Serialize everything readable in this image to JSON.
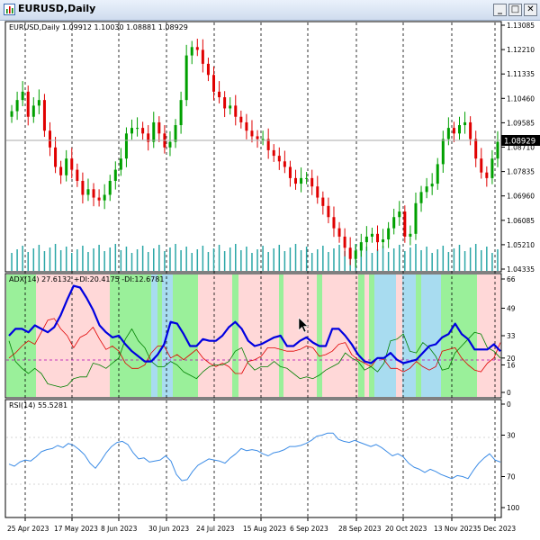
{
  "window": {
    "title": "EURUSD,Daily",
    "buttons": {
      "minimize": "_",
      "restore": "□",
      "close": "✕"
    }
  },
  "main_panel": {
    "header": "EURUSD,Daily  1.09912 1.10030 1.08881 1.08929",
    "current_price": "1.08929",
    "price_ticks": [
      "1.13085",
      "1.12210",
      "1.11335",
      "1.10460",
      "1.09585",
      "1.08710",
      "1.07835",
      "1.06960",
      "1.06085",
      "1.05210",
      "1.04335"
    ]
  },
  "adx_panel": {
    "header": "ADX(14) 27.6132 +DI:20.4175 -DI:12.6781",
    "ticks": [
      "66",
      "49",
      "33",
      "20",
      "16",
      "0"
    ]
  },
  "rsi_panel": {
    "header": "RSI(14) 55.5281",
    "ticks": [
      "100",
      "70",
      "30",
      "0"
    ]
  },
  "date_ticks": [
    "25 Apr 2023",
    "17 May 2023",
    "8 Jun 2023",
    "30 Jun 2023",
    "24 Jul 2023",
    "15 Aug 2023",
    "6 Sep 2023",
    "28 Sep 2023",
    "20 Oct 2023",
    "13 Nov 2023",
    "5 Dec 2023"
  ],
  "colors": {
    "bull_candle": "#00a000",
    "bear_candle": "#e00000",
    "volume": "#2aa6a6",
    "adx": "#0000e0",
    "plus_di": "#008000",
    "minus_di": "#e00000",
    "rsi": "#3c8ce6",
    "zone_green": "#9af09a",
    "zone_pink": "#ffd8d8",
    "zone_cyan": "#a8dcf0"
  },
  "chart_data": {
    "type": "line",
    "x_range": [
      "25 Apr 2023",
      "12 Dec 2023"
    ],
    "price_series": [
      1.1,
      1.104,
      1.107,
      1.098,
      1.102,
      1.104,
      1.093,
      1.087,
      1.08,
      1.077,
      1.083,
      1.079,
      1.075,
      1.07,
      1.072,
      1.069,
      1.068,
      1.07,
      1.075,
      1.079,
      1.083,
      1.092,
      1.094,
      1.094,
      1.092,
      1.089,
      1.096,
      1.092,
      1.087,
      1.089,
      1.095,
      1.104,
      1.12,
      1.123,
      1.122,
      1.117,
      1.113,
      1.107,
      1.105,
      1.101,
      1.102,
      1.098,
      1.096,
      1.093,
      1.091,
      1.09,
      1.09,
      1.086,
      1.084,
      1.082,
      1.08,
      1.076,
      1.074,
      1.076,
      1.076,
      1.073,
      1.069,
      1.066,
      1.062,
      1.058,
      1.055,
      1.051,
      1.047,
      1.05,
      1.053,
      1.055,
      1.056,
      1.053,
      1.054,
      1.058,
      1.062,
      1.064,
      1.055,
      1.056,
      1.067,
      1.071,
      1.073,
      1.074,
      1.081,
      1.09,
      1.094,
      1.092,
      1.095,
      1.096,
      1.09,
      1.083,
      1.078,
      1.076,
      1.083,
      1.089
    ],
    "adx_series": [
      33,
      37,
      37,
      35,
      39,
      37,
      35,
      38,
      45,
      54,
      62,
      61,
      55,
      48,
      39,
      35,
      32,
      33,
      28,
      24,
      21,
      18,
      18,
      22,
      28,
      41,
      40,
      34,
      27,
      27,
      31,
      30,
      30,
      33,
      38,
      41,
      37,
      30,
      27,
      28,
      30,
      32,
      33,
      27,
      27,
      30,
      32,
      29,
      27,
      27,
      37,
      37,
      33,
      28,
      22,
      18,
      17,
      20,
      20,
      23,
      19,
      17,
      18,
      19,
      23,
      27,
      28,
      32,
      34,
      40,
      34,
      31,
      25,
      25,
      25,
      28,
      24
    ],
    "plus_di_series": [
      30,
      18,
      14,
      11,
      14,
      11,
      5,
      4,
      3,
      4,
      8,
      9,
      9,
      17,
      16,
      14,
      17,
      20,
      31,
      37,
      30,
      26,
      18,
      15,
      15,
      18,
      16,
      12,
      10,
      8,
      12,
      15,
      16,
      16,
      18,
      24,
      26,
      17,
      13,
      15,
      15,
      18,
      15,
      14,
      11,
      8,
      9,
      8,
      10,
      13,
      15,
      17,
      23,
      20,
      18,
      13,
      15,
      12,
      17,
      30,
      31,
      34,
      24,
      23,
      29,
      26,
      21,
      13,
      14,
      23,
      27,
      31,
      35,
      34,
      26,
      24,
      20
    ],
    "minus_di_series": [
      20,
      23,
      27,
      30,
      28,
      35,
      42,
      43,
      37,
      33,
      26,
      32,
      34,
      38,
      31,
      25,
      27,
      24,
      17,
      14,
      14,
      16,
      23,
      27,
      27,
      20,
      22,
      19,
      22,
      25,
      20,
      17,
      15,
      17,
      15,
      11,
      11,
      18,
      19,
      21,
      26,
      26,
      25,
      24,
      24,
      25,
      27,
      26,
      21,
      22,
      24,
      28,
      29,
      22,
      19,
      17,
      15,
      20,
      19,
      14,
      14,
      12,
      14,
      18,
      15,
      13,
      15,
      24,
      25,
      26,
      20,
      16,
      13,
      12,
      17,
      20,
      29
    ],
    "rsi_series": [
      58,
      60,
      56,
      54,
      55,
      51,
      46,
      44,
      43,
      40,
      42,
      38,
      40,
      44,
      49,
      57,
      62,
      55,
      47,
      41,
      37,
      36,
      39,
      47,
      53,
      52,
      56,
      55,
      54,
      50,
      55,
      68,
      74,
      73,
      65,
      59,
      56,
      53,
      54,
      55,
      57,
      52,
      48,
      43,
      45,
      44,
      45,
      48,
      50,
      47,
      46,
      44,
      41,
      41,
      40,
      38,
      35,
      31,
      30,
      28,
      28,
      34,
      36,
      37,
      35,
      37,
      39,
      41,
      39,
      42,
      46,
      50,
      48,
      51,
      57,
      61,
      63,
      66,
      63,
      65,
      68,
      70,
      72,
      69,
      70,
      72,
      64,
      57,
      52,
      48,
      54,
      56
    ]
  }
}
